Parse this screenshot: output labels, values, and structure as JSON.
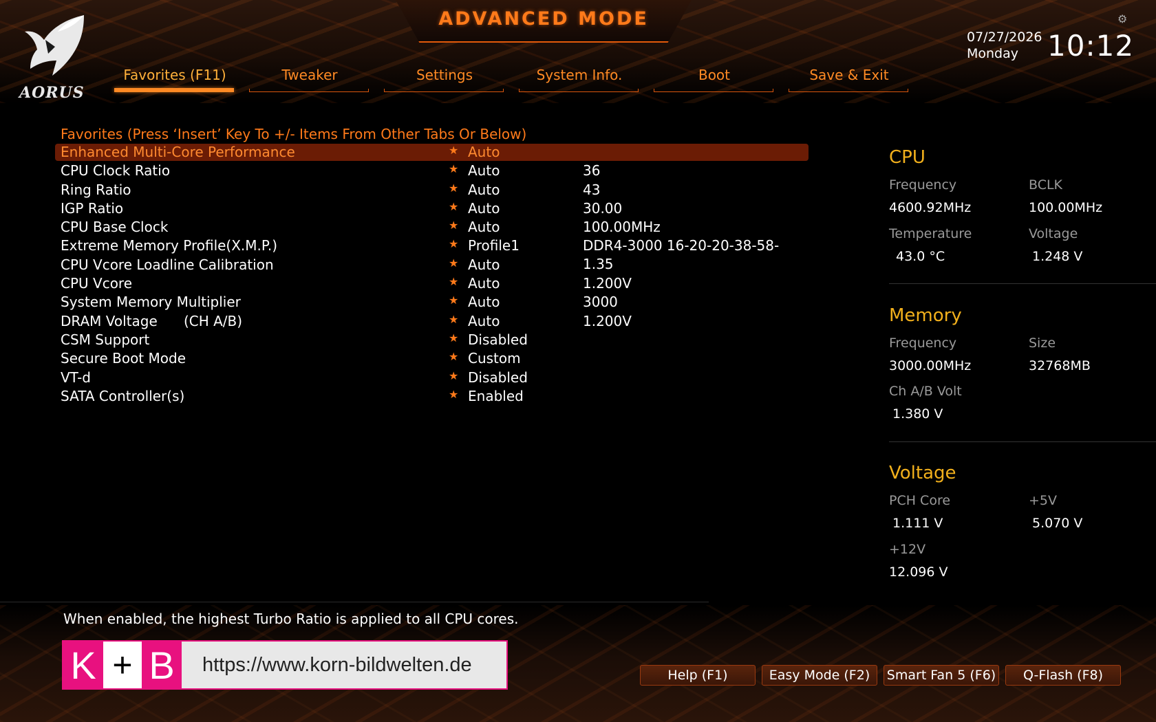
{
  "header": {
    "mode_title": "ADVANCED MODE",
    "brand": "AORUS",
    "date": "07/27/2026",
    "weekday": "Monday",
    "time": "10:12"
  },
  "tabs": [
    {
      "label": "Favorites (F11)",
      "active": true
    },
    {
      "label": "Tweaker"
    },
    {
      "label": "Settings"
    },
    {
      "label": "System Info."
    },
    {
      "label": "Boot"
    },
    {
      "label": "Save & Exit"
    }
  ],
  "favorites": {
    "header": "Favorites (Press ‘Insert’ Key To +/- Items From Other Tabs Or Below)",
    "rows": [
      {
        "name": "Enhanced Multi-Core Performance",
        "value": "Auto",
        "current": ""
      },
      {
        "name": "CPU Clock Ratio",
        "value": "Auto",
        "current": "36"
      },
      {
        "name": "Ring Ratio",
        "value": "Auto",
        "current": "43"
      },
      {
        "name": "IGP Ratio",
        "value": "Auto",
        "current": "30.00"
      },
      {
        "name": "CPU Base Clock",
        "value": "Auto",
        "current": "100.00MHz"
      },
      {
        "name": "Extreme Memory Profile(X.M.P.)",
        "value": "Profile1",
        "current": "DDR4-3000 16-20-20-38-58-1.35"
      },
      {
        "name": "CPU Vcore Loadline Calibration",
        "value": "Auto",
        "current": ""
      },
      {
        "name": "CPU Vcore",
        "value": "Auto",
        "current": "1.200V"
      },
      {
        "name": "System Memory Multiplier",
        "value": "Auto",
        "current": "3000"
      },
      {
        "name": "DRAM Voltage      (CH A/B)",
        "value": "Auto",
        "current": "1.200V"
      },
      {
        "name": "CSM Support",
        "value": "Disabled",
        "current": ""
      },
      {
        "name": "Secure Boot Mode",
        "value": "Custom",
        "current": ""
      },
      {
        "name": "VT-d",
        "value": "Disabled",
        "current": ""
      },
      {
        "name": "SATA Controller(s)",
        "value": "Enabled",
        "current": ""
      }
    ]
  },
  "info": {
    "cpu": {
      "title": "CPU",
      "frequency_label": "Frequency",
      "frequency": "4600.92MHz",
      "bclk_label": "BCLK",
      "bclk": "100.00MHz",
      "temperature_label": "Temperature",
      "temperature": "43.0 °C",
      "voltage_label": "Voltage",
      "voltage": "1.248 V"
    },
    "memory": {
      "title": "Memory",
      "frequency_label": "Frequency",
      "frequency": "3000.00MHz",
      "size_label": "Size",
      "size": "32768MB",
      "chab_label": "Ch A/B Volt",
      "chab": "1.380 V"
    },
    "voltage": {
      "title": "Voltage",
      "pch_label": "PCH Core",
      "pch": "1.111 V",
      "p5v_label": "+5V",
      "p5v": "5.070 V",
      "p12v_label": "+12V",
      "p12v": "12.096 V"
    }
  },
  "help_text": "When enabled, the highest Turbo Ratio is applied to all CPU cores.",
  "watermark": {
    "k": "K",
    "plus": "+",
    "b": "B",
    "url": "https://www.korn-bildwelten.de"
  },
  "buttons": [
    {
      "label": "Help (F1)"
    },
    {
      "label": "Easy Mode (F2)"
    },
    {
      "label": "Smart Fan 5 (F6)"
    },
    {
      "label": "Q-Flash (F8)"
    }
  ],
  "colors": {
    "accent": "#ff7a1a",
    "section_title": "#f2b01c",
    "selected_row": "#6b1c05"
  }
}
